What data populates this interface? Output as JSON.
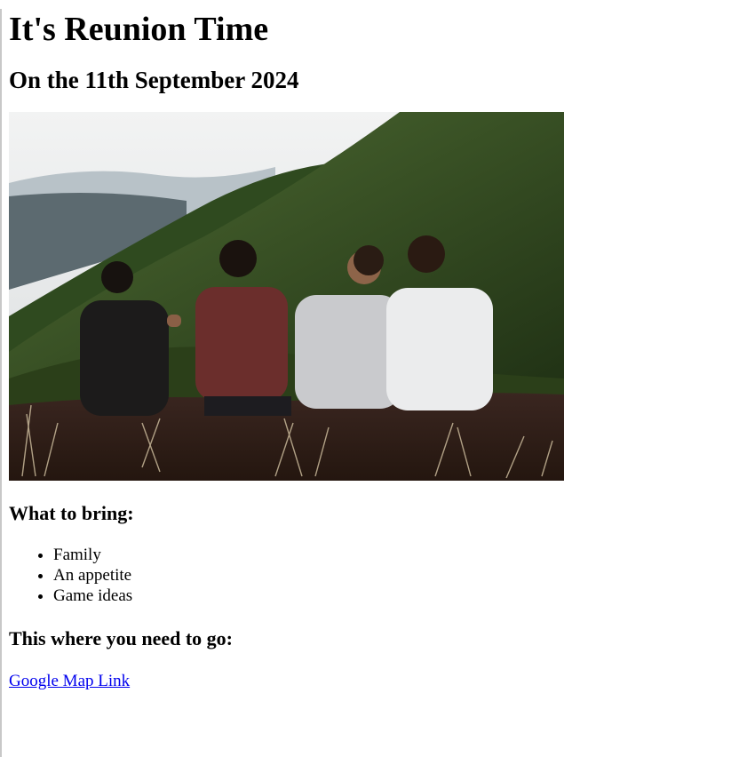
{
  "heading": "It's Reunion Time",
  "date": "On the 11th September 2024",
  "bring": {
    "heading": "What to bring:",
    "items": [
      "Family",
      "An appetite",
      "Game ideas"
    ]
  },
  "location": {
    "heading": "This where you need to go:",
    "link_text": "Google Map Link"
  },
  "colors": {
    "link": "#0000ee"
  }
}
